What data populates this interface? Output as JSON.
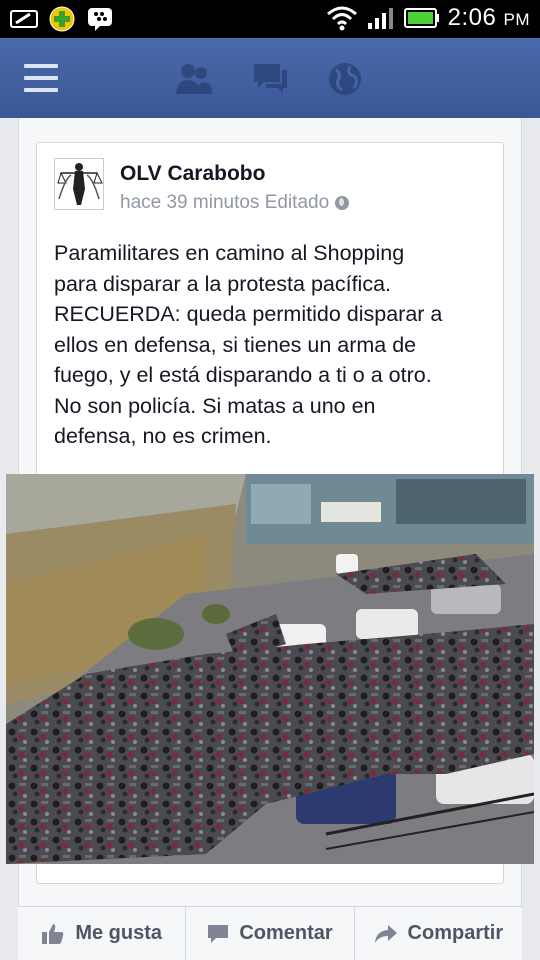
{
  "status_bar": {
    "time": "2:06",
    "ampm": "PM",
    "colors": {
      "battery": "#4cd137",
      "notify_plus": "#f5c400"
    }
  },
  "top_bar": {
    "icons": [
      "menu-icon",
      "friend-requests-icon",
      "messages-icon",
      "notifications-globe-icon"
    ],
    "colors": {
      "bar": "#3a5795",
      "icon": "#dde4f1"
    }
  },
  "post": {
    "author": "OLV Carabobo",
    "time_meta": "hace 39 minutos Editado",
    "privacy_icon": "globe-icon",
    "text": "Paramilitares en camino al Shopping\npara disparar a la protesta pacífica.\nRECUERDA: queda permitido disparar a\nellos en defensa, si tienes un arma de\nfuego, y el está disparando a ti o a otro.\nNo son policía. Si matas a uno en\ndefensa, no es crimen.",
    "photo_icon": "photo-crowd-motorcycles"
  },
  "actions": {
    "like": "Me gusta",
    "comment": "Comentar",
    "share": "Compartir"
  }
}
